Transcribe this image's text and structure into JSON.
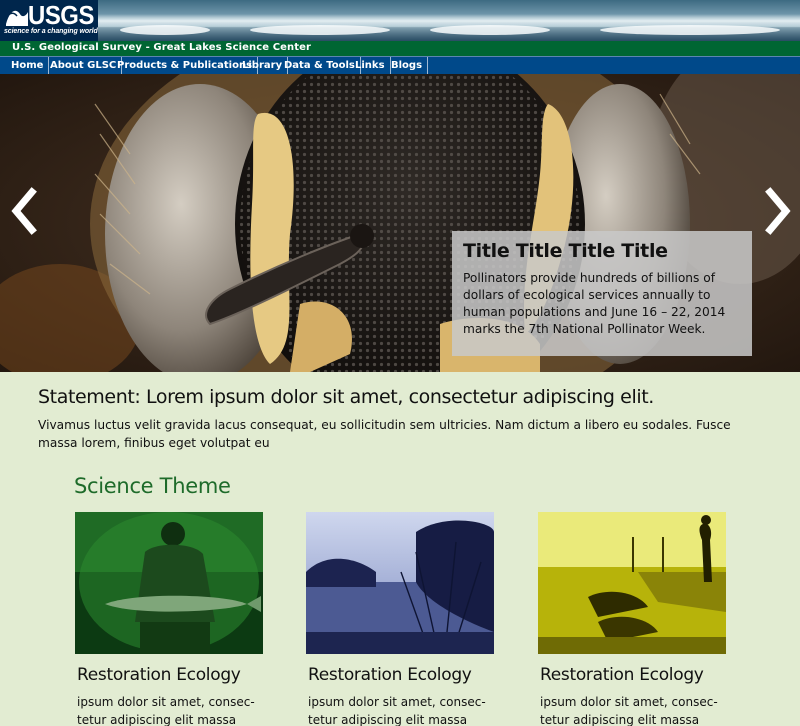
{
  "header": {
    "logo_text": "USGS",
    "logo_tagline": "science for a changing world",
    "site_title": "U.S. Geological Survey - Great Lakes Science Center"
  },
  "nav": {
    "items": [
      {
        "label": "Home"
      },
      {
        "label": "About GLSC"
      },
      {
        "label": "Products & Publications"
      },
      {
        "label": "Library"
      },
      {
        "label": "Data & Tools"
      },
      {
        "label": "Links"
      },
      {
        "label": "Blogs"
      }
    ]
  },
  "hero": {
    "image": "bee-face-closeup",
    "prev_icon": "chevron-left-icon",
    "next_icon": "chevron-right-icon",
    "caption": {
      "title": "Title Title Title Title",
      "body": "Pollinators provide hundreds of billions of dollars of ecological services annually to human populations and June 16 – 22, 2014 marks the 7th National Pollinator Week."
    }
  },
  "statement": {
    "title": "Statement: Lorem ipsum dolor sit amet, consectetur adipiscing elit.",
    "body": "Vivamus luctus velit gravida lacus consequat, eu sollicitudin sem ultricies. Nam dictum a libero eu sodales. Fusce massa lorem, finibus eget volutpat eu"
  },
  "science_theme": {
    "heading": "Science Theme",
    "cards": [
      {
        "title": "Restoration Ecology",
        "text": "ipsum dolor sit amet, consec-tetur adipiscing elit massa",
        "image": "fisherman-holding-fish-green-tint"
      },
      {
        "title": "Restoration Ecology",
        "text": "ipsum dolor sit amet, consec-tetur adipiscing elit massa",
        "image": "misty-lake-blue-tint"
      },
      {
        "title": "Restoration Ecology",
        "text": "ipsum dolor sit amet, consec-tetur adipiscing elit massa",
        "image": "person-on-pier-yellow-tint"
      }
    ]
  },
  "colors": {
    "page_background": "#e2ecd2",
    "header_green": "#006633",
    "nav_blue": "#00498a",
    "logo_navy": "#00264c",
    "theme_heading": "#1e6b2a"
  }
}
